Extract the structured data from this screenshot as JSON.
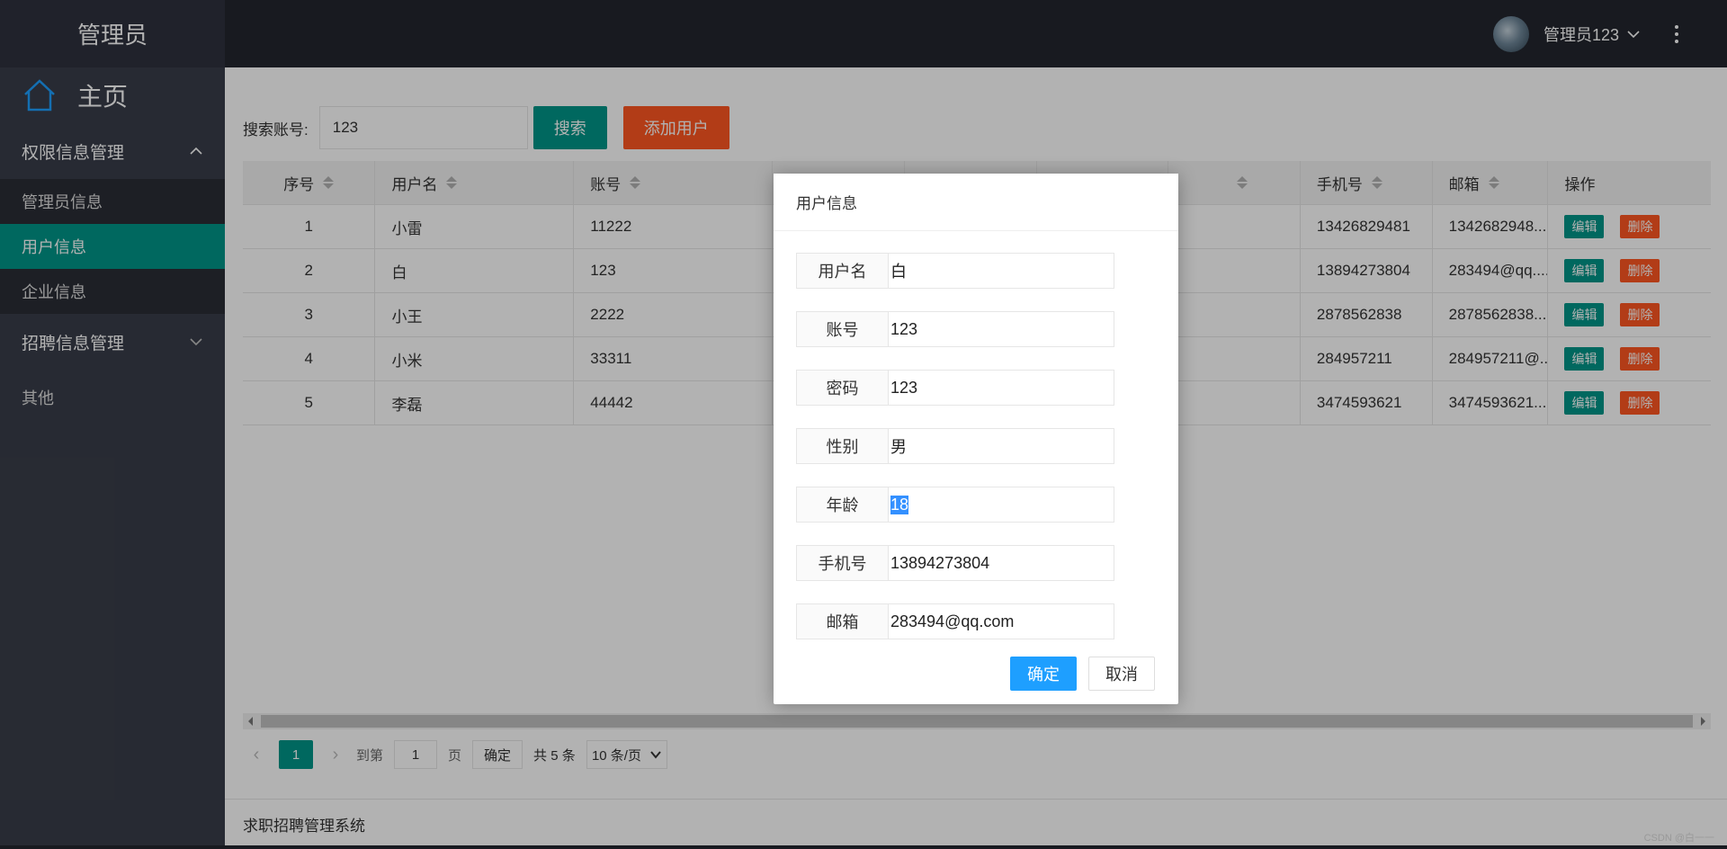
{
  "sidebar": {
    "logo": "管理员",
    "home": "主页",
    "groups": [
      {
        "label": "权限信息管理",
        "items": [
          "管理员信息",
          "用户信息",
          "企业信息"
        ],
        "active": "用户信息"
      },
      {
        "label": "招聘信息管理"
      }
    ],
    "other": "其他"
  },
  "header": {
    "user": "管理员123"
  },
  "toolbar": {
    "search_label": "搜索账号:",
    "search_value": "123",
    "search_button": "搜索",
    "add_button": "添加用户"
  },
  "table": {
    "headers": [
      "序号",
      "用户名",
      "账号",
      "",
      "",
      "",
      "",
      "手机号",
      "邮箱",
      "操作"
    ],
    "rows": [
      {
        "no": "1",
        "name": "小雷",
        "account": "11222",
        "phone": "13426829481",
        "email": "1342682948..."
      },
      {
        "no": "2",
        "name": "白",
        "account": "123",
        "phone": "13894273804",
        "email": "283494@qq...."
      },
      {
        "no": "3",
        "name": "小王",
        "account": "2222",
        "phone": "2878562838",
        "email": "2878562838..."
      },
      {
        "no": "4",
        "name": "小米",
        "account": "33311",
        "phone": "284957211",
        "email": "284957211@..."
      },
      {
        "no": "5",
        "name": "李磊",
        "account": "44442",
        "phone": "3474593621",
        "email": "3474593621..."
      }
    ],
    "edit_label": "编辑",
    "delete_label": "删除"
  },
  "pager": {
    "current": "1",
    "goto_label": "到第",
    "goto_value": "1",
    "page_label": "页",
    "ok": "确定",
    "total": "共 5 条",
    "size": "10 条/页"
  },
  "footer": "求职招聘管理系统",
  "watermark": "CSDN @白一一",
  "dialog": {
    "title": "用户信息",
    "fields": [
      {
        "label": "用户名",
        "value": "白"
      },
      {
        "label": "账号",
        "value": "123"
      },
      {
        "label": "密码",
        "value": "123"
      },
      {
        "label": "性别",
        "value": "男"
      },
      {
        "label": "年龄",
        "value": "18"
      },
      {
        "label": "手机号",
        "value": "13894273804"
      },
      {
        "label": "邮箱",
        "value": "283494@qq.com"
      }
    ],
    "ok": "确定",
    "cancel": "取消"
  },
  "colors": {
    "primary": "#009688",
    "danger": "#ff5722",
    "accent": "#1e9fff",
    "sidebar": "#393d49",
    "header": "#23262e"
  }
}
